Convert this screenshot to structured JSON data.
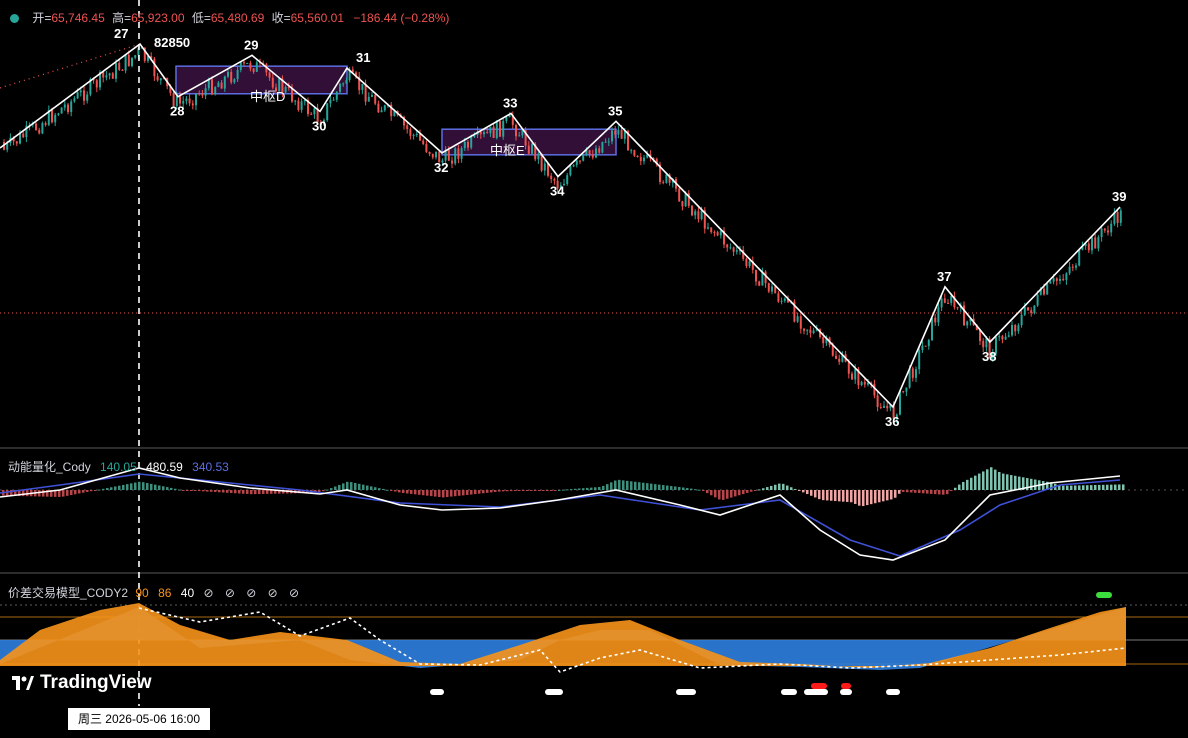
{
  "header": {
    "open_label": "开=",
    "open": "65,746.45",
    "high_label": "高=",
    "high": "65,923.00",
    "low_label": "低=",
    "low": "65,480.69",
    "close_label": "收=",
    "close": "65,560.01",
    "change": "−186.44 (−0.28%)"
  },
  "labels": {
    "peak_value": "82850",
    "zs_d": "中枢D",
    "zs_e": "中枢E",
    "waves": [
      "27",
      "28",
      "29",
      "30",
      "31",
      "32",
      "33",
      "34",
      "35",
      "36",
      "37",
      "38",
      "39"
    ]
  },
  "indicator1": {
    "name": "动能量化_Cody",
    "v1": "140.05",
    "v2": "480.59",
    "v3": "340.53"
  },
  "indicator2": {
    "name": "价差交易模型_CODY2",
    "v1": "90",
    "v2": "86",
    "v3": "40",
    "extras": "⊘ ⊘ ⊘ ⊘ ⊘"
  },
  "footer": {
    "brand": "TradingView",
    "date": "周三  2026-05-06   16:00"
  },
  "colors": {
    "up": "#26a69a",
    "down": "#ef5350",
    "zs_border": "#5b6ee1",
    "zs_fill": "#3a1240",
    "orange": "#f7931a",
    "blue": "#2f7fe0",
    "macd_dif": "#ffffff",
    "macd_dea": "#3f51d6"
  },
  "chart_data": {
    "type": "line",
    "title": "",
    "price_path": [
      {
        "wave": "27",
        "price": 82850
      },
      {
        "wave": "28",
        "price": 77500
      },
      {
        "wave": "29",
        "price": 81700
      },
      {
        "wave": "30",
        "price": 76000
      },
      {
        "wave": "31",
        "price": 80400
      },
      {
        "wave": "32",
        "price": 71800
      },
      {
        "wave": "33",
        "price": 75800
      },
      {
        "wave": "34",
        "price": 69400
      },
      {
        "wave": "35",
        "price": 75000
      },
      {
        "wave": "36",
        "price": 46000
      },
      {
        "wave": "37",
        "price": 58200
      },
      {
        "wave": "38",
        "price": 52600
      },
      {
        "wave": "39",
        "price": 66300
      }
    ],
    "last_close": 65560.01,
    "zhongshu": [
      {
        "name": "中枢D",
        "high": 80600,
        "low": 77800
      },
      {
        "name": "中枢E",
        "high": 74200,
        "low": 71600
      }
    ]
  }
}
